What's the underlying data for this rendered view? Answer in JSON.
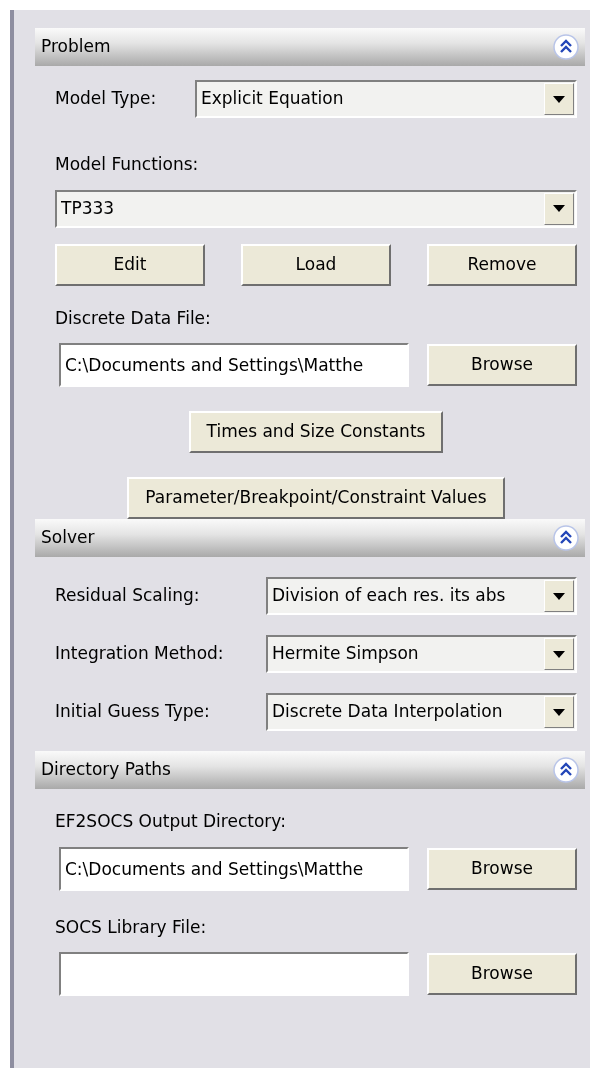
{
  "sections": [
    {
      "title": "Problem",
      "expanded": true,
      "items": [
        {
          "kind": "select_row",
          "label": "Model Type:",
          "value": "Explicit Equation"
        },
        {
          "kind": "label",
          "text": "Model Functions:"
        },
        {
          "kind": "select",
          "value": "TP333"
        },
        {
          "kind": "buttons",
          "buttons": [
            "Edit",
            "Load",
            "Remove"
          ]
        },
        {
          "kind": "label",
          "text": "Discrete Data File:"
        },
        {
          "kind": "file_row",
          "value": "C:\\Documents and Settings\\Matthe",
          "button": "Browse"
        },
        {
          "kind": "button",
          "text": "Times and Size Constants"
        },
        {
          "kind": "button",
          "text": "Parameter/Breakpoint/Constraint Values"
        }
      ]
    },
    {
      "title": "Solver",
      "expanded": true,
      "items": [
        {
          "kind": "select_row",
          "label": "Residual Scaling:",
          "value": "Division of each res. its abs"
        },
        {
          "kind": "select_row",
          "label": "Integration Method:",
          "value": "Hermite Simpson"
        },
        {
          "kind": "select_row",
          "label": "Initial Guess Type:",
          "value": "Discrete Data Interpolation"
        }
      ]
    },
    {
      "title": "Directory Paths",
      "expanded": true,
      "items": [
        {
          "kind": "label",
          "text": "EF2SOCS Output Directory:"
        },
        {
          "kind": "file_row",
          "value": "C:\\Documents and Settings\\Matthe",
          "button": "Browse"
        },
        {
          "kind": "label",
          "text": "SOCS Library File:"
        },
        {
          "kind": "file_row",
          "value": "",
          "button": "Browse"
        }
      ]
    }
  ]
}
